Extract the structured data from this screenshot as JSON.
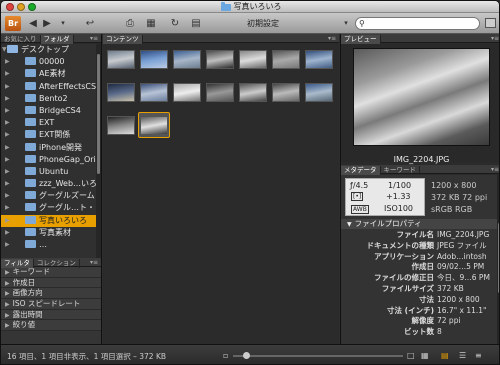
{
  "window": {
    "title": "写真いろいろ"
  },
  "toolbar": {
    "workspace": "初期設定",
    "search_placeholder": "",
    "br_label": "Br"
  },
  "left_tabs": [
    "お気に入り",
    "フォルダ"
  ],
  "folders": [
    {
      "label": "デスクトップ",
      "top": true
    },
    {
      "label": "00000"
    },
    {
      "label": "AE素材"
    },
    {
      "label": "AfterEffectsCS"
    },
    {
      "label": "Bento2"
    },
    {
      "label": "BridgeCS4"
    },
    {
      "label": "EXT"
    },
    {
      "label": "EXT関係"
    },
    {
      "label": "iPhone開発"
    },
    {
      "label": "PhoneGap_Ori"
    },
    {
      "label": "Ubuntu"
    },
    {
      "label": "zzz_Web…いろ"
    },
    {
      "label": "グーグルズーム"
    },
    {
      "label": "グーグル…ト・ビ"
    },
    {
      "label": "写真いろいろ",
      "selected": true
    },
    {
      "label": "写真素材"
    },
    {
      "label": "…"
    }
  ],
  "filter_tabs": [
    "フィルタ",
    "コレクション"
  ],
  "filters": [
    "キーワード",
    "作成日",
    "画像方向",
    "ISO スピードレート",
    "露出時間",
    "絞り値"
  ],
  "content_tab": "コンテンツ",
  "thumbnails": [
    {
      "colors": [
        "#6d7c8c",
        "#c9ccd0",
        "#556070"
      ]
    },
    {
      "colors": [
        "#2f4e86",
        "#7aa0d4",
        "#b9cbe3"
      ]
    },
    {
      "colors": [
        "#3b5f93",
        "#a8b7c9",
        "#6b7d90"
      ]
    },
    {
      "colors": [
        "#4d4d4d",
        "#bfbfbf",
        "#2c2c2c"
      ]
    },
    {
      "colors": [
        "#888",
        "#ddd",
        "#666"
      ]
    },
    {
      "colors": [
        "#555",
        "#aaa",
        "#777"
      ]
    },
    {
      "colors": [
        "#304d7a",
        "#9fb5d0",
        "#415b82"
      ]
    },
    {
      "colors": [
        "#1e2a40",
        "#5a6a8a",
        "#c8c0a8"
      ]
    },
    {
      "colors": [
        "#3a4f7a",
        "#b8c4d6",
        "#6a7d9c"
      ]
    },
    {
      "colors": [
        "#aaa",
        "#eee",
        "#777"
      ]
    },
    {
      "colors": [
        "#333",
        "#999",
        "#555"
      ]
    },
    {
      "colors": [
        "#555",
        "#ccc",
        "#444"
      ]
    },
    {
      "colors": [
        "#444",
        "#bbb",
        "#666"
      ]
    },
    {
      "colors": [
        "#3a5a8a",
        "#aabbcc",
        "#556677"
      ]
    },
    {
      "colors": [
        "#222",
        "#888",
        "#ddd"
      ]
    },
    {
      "colors": [
        "#5a5a5a",
        "#e0e0e0",
        "#3a3a3a"
      ],
      "selected": true
    }
  ],
  "preview": {
    "tab": "プレビュー",
    "caption": "IMG_2204.JPG"
  },
  "meta_tabs": [
    "メタデータ",
    "キーワード"
  ],
  "camera": {
    "aperture": "ƒ/4.5",
    "shutter": "1/100",
    "ev": "+1.33",
    "iso": "ISO100",
    "awb": "AWB"
  },
  "info": [
    "1200 x 800",
    "372 KB  72 ppi",
    "sRGB      RGB"
  ],
  "file_props": {
    "header": "ファイルプロパティ",
    "rows": [
      {
        "k": "ファイル名",
        "v": "IMG_2204.JPG"
      },
      {
        "k": "ドキュメントの種類",
        "v": "JPEG ファイル"
      },
      {
        "k": "アプリケーション",
        "v": "Adob…intosh"
      },
      {
        "k": "作成日",
        "v": "09/02…5 PM"
      },
      {
        "k": "ファイルの修正日",
        "v": "今日、9…6 PM"
      },
      {
        "k": "ファイルサイズ",
        "v": "372 KB"
      },
      {
        "k": "寸法",
        "v": "1200 x 800"
      },
      {
        "k": "寸法 (インチ)",
        "v": "16.7\" x 11.1\""
      },
      {
        "k": "解像度",
        "v": "72 ppi"
      },
      {
        "k": "ビット数",
        "v": "8"
      }
    ]
  },
  "status": {
    "text": "16 項目、1 項目非表示、1 項目選択 – 372 KB"
  }
}
